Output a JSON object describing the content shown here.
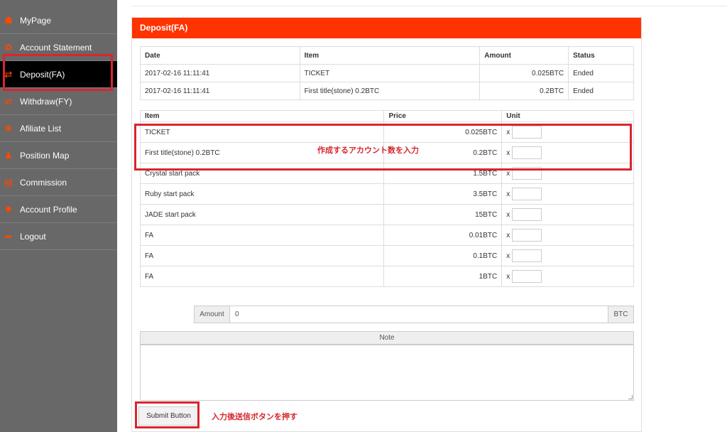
{
  "sidebar": {
    "items": [
      {
        "label": "MyPage",
        "icon": "home-icon",
        "glyph": "☗"
      },
      {
        "label": "Account Statement",
        "icon": "gear-icon",
        "glyph": "✿"
      },
      {
        "label": "Deposit(FA)",
        "icon": "transfer-icon",
        "glyph": "⇄"
      },
      {
        "label": "Withdraw(FY)",
        "icon": "transfer-icon",
        "glyph": "⇄"
      },
      {
        "label": "Afiliate List",
        "icon": "users-icon",
        "glyph": "❀"
      },
      {
        "label": "Position Map",
        "icon": "person-icon",
        "glyph": "♟"
      },
      {
        "label": "Commission",
        "icon": "card-icon",
        "glyph": "▤"
      },
      {
        "label": "Account Profile",
        "icon": "settings-icon",
        "glyph": "✹"
      },
      {
        "label": "Logout",
        "icon": "logout-icon",
        "glyph": "➦"
      }
    ],
    "active_index": 2
  },
  "panel": {
    "title": "Deposit(FA)"
  },
  "history": {
    "headers": [
      "Date",
      "Item",
      "Amount",
      "Status"
    ],
    "rows": [
      {
        "date": "2017-02-16 11:11:41",
        "item": "TICKET",
        "amount": "0.025BTC",
        "status": "Ended"
      },
      {
        "date": "2017-02-16 11:11:41",
        "item": "First title(stone) 0.2BTC",
        "amount": "0.2BTC",
        "status": "Ended"
      }
    ]
  },
  "items": {
    "headers": [
      "Item",
      "Price",
      "Unit"
    ],
    "qty_prefix": "x",
    "rows": [
      {
        "item": "TICKET",
        "price": "0.025BTC"
      },
      {
        "item": "First title(stone) 0.2BTC",
        "price": "0.2BTC"
      },
      {
        "item": "Crystal start pack",
        "price": "1.5BTC"
      },
      {
        "item": "Ruby start pack",
        "price": "3.5BTC"
      },
      {
        "item": "JADE start pack",
        "price": "15BTC"
      },
      {
        "item": "FA",
        "price": "0.01BTC"
      },
      {
        "item": "FA",
        "price": "0.1BTC"
      },
      {
        "item": "FA",
        "price": "1BTC"
      }
    ]
  },
  "amount": {
    "label": "Amount",
    "value": "0",
    "unit": "BTC"
  },
  "note": {
    "label": "Note"
  },
  "submit": {
    "label": "Submit Button"
  },
  "annotations": {
    "qty_note": "作成するアカウント数を入力",
    "submit_note": "入力後送信ボタンを押す"
  },
  "colors": {
    "accent": "#ff3300",
    "sidebar": "#686868",
    "annotation": "#d8262e"
  }
}
